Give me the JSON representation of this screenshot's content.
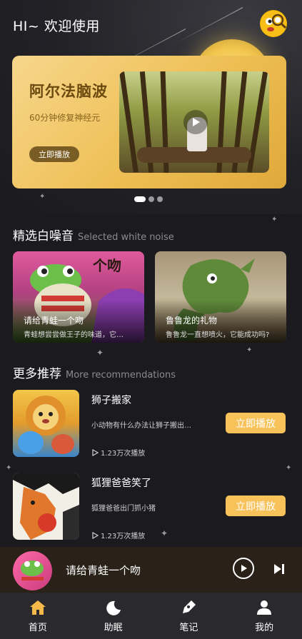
{
  "header": {
    "welcome": "HI~ 欢迎使用"
  },
  "banner": {
    "title": "阿尔法脑波",
    "subtitle": "60分钟修复神经元",
    "button": "立即播放"
  },
  "white_noise": {
    "title": "精选白噪音",
    "title_en": "Selected white noise",
    "items": [
      {
        "title": "请给青蛙一个吻",
        "desc": "青蛙想尝尝做王子的味道，它…",
        "art_text": "个吻"
      },
      {
        "title": "鲁鲁龙的礼物",
        "desc": "鲁鲁龙一直想喷火，它能成功吗?"
      }
    ]
  },
  "recommendations": {
    "title": "更多推荐",
    "title_en": "More recommendations",
    "items": [
      {
        "title": "狮子搬家",
        "desc": "小动物有什么办法让狮子搬出…",
        "plays": "1.23万次播放",
        "button": "立即播放"
      },
      {
        "title": "狐狸爸爸笑了",
        "desc": "狐狸爸爸出门抓小猪",
        "plays": "1.23万次播放",
        "button": "立即播放"
      }
    ]
  },
  "player": {
    "title": "请给青蛙一个吻"
  },
  "tabs": [
    {
      "label": "首页",
      "icon": "home-icon",
      "active": true
    },
    {
      "label": "助眠",
      "icon": "moon-sleep-icon"
    },
    {
      "label": "笔记",
      "icon": "pen-icon"
    },
    {
      "label": "我的",
      "icon": "user-icon"
    }
  ],
  "colors": {
    "accent": "#f7c25a",
    "active_tab": "#f5b84a",
    "background": "#1b1b1f"
  }
}
